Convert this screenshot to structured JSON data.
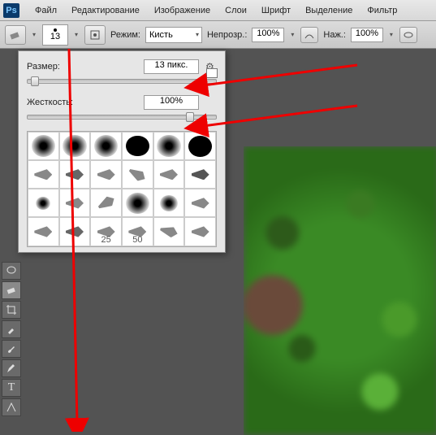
{
  "app": {
    "logo": "Ps"
  },
  "menu": [
    "Файл",
    "Редактирование",
    "Изображение",
    "Слои",
    "Шрифт",
    "Выделение",
    "Фильтр"
  ],
  "optbar": {
    "brush_size": "13",
    "mode_label": "Режим:",
    "mode_value": "Кисть",
    "opacity_label": "Непрозр.:",
    "opacity_value": "100%",
    "flow_label": "Наж.:",
    "flow_value": "100%"
  },
  "panel": {
    "size_label": "Размер:",
    "size_value": "13 пикс.",
    "hardness_label": "Жесткость:",
    "hardness_value": "100%",
    "brush_labels": [
      "25",
      "50"
    ]
  },
  "toolbox_icons": [
    "move",
    "lasso",
    "crop",
    "eyedrop",
    "eraser",
    "pencil",
    "brush",
    "stamp",
    "text",
    "path"
  ]
}
